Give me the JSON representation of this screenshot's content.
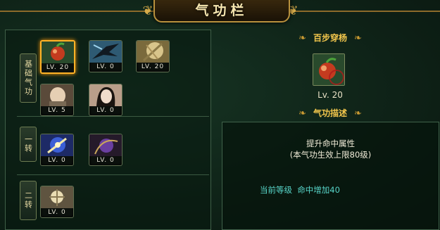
{
  "window": {
    "title": "气功栏"
  },
  "categories": [
    {
      "label": "基础气功"
    },
    {
      "label": "一转"
    },
    {
      "label": "二转"
    }
  ],
  "skills": {
    "base_row1": [
      {
        "icon": "fruit-skill-icon",
        "level": "LV. 20",
        "selected": true
      },
      {
        "icon": "bird-strike-skill-icon",
        "level": "LV. 0"
      },
      {
        "icon": "golden-shield-skill-icon",
        "level": "LV. 20"
      }
    ],
    "base_row2": [
      {
        "icon": "monk-skill-icon",
        "level": "LV. 5"
      },
      {
        "icon": "female-warrior-skill-icon",
        "level": "LV. 0"
      }
    ],
    "first_turn": [
      {
        "icon": "blue-burst-skill-icon",
        "level": "LV. 0"
      },
      {
        "icon": "dark-orb-skill-icon",
        "level": "LV. 0"
      }
    ],
    "second_turn": [
      {
        "icon": "light-tree-skill-icon",
        "level": "LV. 0"
      }
    ]
  },
  "detail": {
    "name": "百步穿杨",
    "level": "Lv. 20",
    "desc_header": "气功描述",
    "desc_line1": "提升命中属性",
    "desc_line2": "(本气功生效上限80级)",
    "current_label": "当前等级",
    "current_effect": "命中增加40"
  },
  "colors": {
    "accent_gold": "#f2c64c",
    "selected_border": "#ffb327",
    "effect_text": "#58d5c9"
  }
}
